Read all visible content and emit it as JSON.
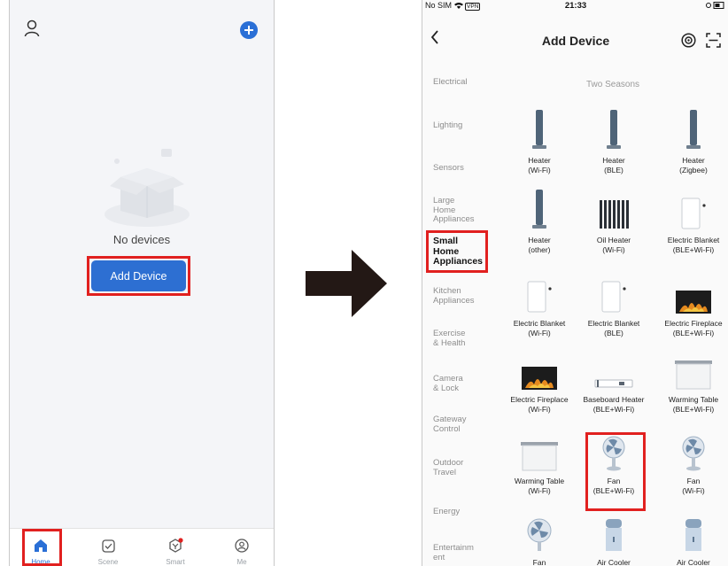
{
  "left": {
    "empty_text": "No devices",
    "add_device_label": "Add Device",
    "tabs": [
      {
        "label": "Home",
        "icon": "home-icon"
      },
      {
        "label": "Scene",
        "icon": "scene-icon"
      },
      {
        "label": "Smart",
        "icon": "smart-icon"
      },
      {
        "label": "Me",
        "icon": "me-icon"
      }
    ]
  },
  "right": {
    "status": {
      "carrier": "No SIM",
      "vpn": "VPN",
      "time": "21:33"
    },
    "title": "Add Device",
    "subheader": "Two Seasons",
    "categories": [
      "Electrical",
      "Lighting",
      "Sensors",
      "Large\nHome\nAppliances",
      "Small\nHome\nAppliances",
      "Kitchen\nAppliances",
      "Exercise\n& Health",
      "Camera\n& Lock",
      "Gateway\nControl",
      "Outdoor\nTravel",
      "Energy",
      "Entertainm\nent"
    ],
    "devices": [
      {
        "name": "Heater",
        "sub": "(Wi-Fi)",
        "icon": "tower-heater-icon"
      },
      {
        "name": "Heater",
        "sub": "(BLE)",
        "icon": "tower-heater-icon"
      },
      {
        "name": "Heater",
        "sub": "(Zigbee)",
        "icon": "tower-heater-icon"
      },
      {
        "name": "Heater",
        "sub": "(other)",
        "icon": "tower-heater-icon"
      },
      {
        "name": "Oil Heater",
        "sub": "(Wi-Fi)",
        "icon": "oil-heater-icon"
      },
      {
        "name": "Electric Blanket",
        "sub": "(BLE+Wi-Fi)",
        "icon": "electric-blanket-icon"
      },
      {
        "name": "Electric Blanket",
        "sub": "(Wi-Fi)",
        "icon": "electric-blanket-icon"
      },
      {
        "name": "Electric Blanket",
        "sub": "(BLE)",
        "icon": "electric-blanket-icon"
      },
      {
        "name": "Electric Fireplace",
        "sub": "(BLE+Wi-Fi)",
        "icon": "fireplace-icon"
      },
      {
        "name": "Electric Fireplace",
        "sub": "(Wi-Fi)",
        "icon": "fireplace-icon"
      },
      {
        "name": "Baseboard Heater",
        "sub": "(BLE+Wi-Fi)",
        "icon": "baseboard-heater-icon"
      },
      {
        "name": "Warming Table",
        "sub": "(BLE+Wi-Fi)",
        "icon": "warming-table-icon"
      },
      {
        "name": "Warming Table",
        "sub": "(Wi-Fi)",
        "icon": "warming-table-icon"
      },
      {
        "name": "Fan",
        "sub": "(BLE+Wi-Fi)",
        "icon": "fan-icon"
      },
      {
        "name": "Fan",
        "sub": "(Wi-Fi)",
        "icon": "fan-icon"
      },
      {
        "name": "Fan",
        "sub": "",
        "icon": "fan-icon"
      },
      {
        "name": "Air Cooler",
        "sub": "",
        "icon": "air-cooler-icon"
      },
      {
        "name": "Air Cooler",
        "sub": "",
        "icon": "air-cooler-icon"
      }
    ]
  },
  "colors": {
    "accent": "#2d6fd2",
    "highlight": "#e1201f"
  }
}
